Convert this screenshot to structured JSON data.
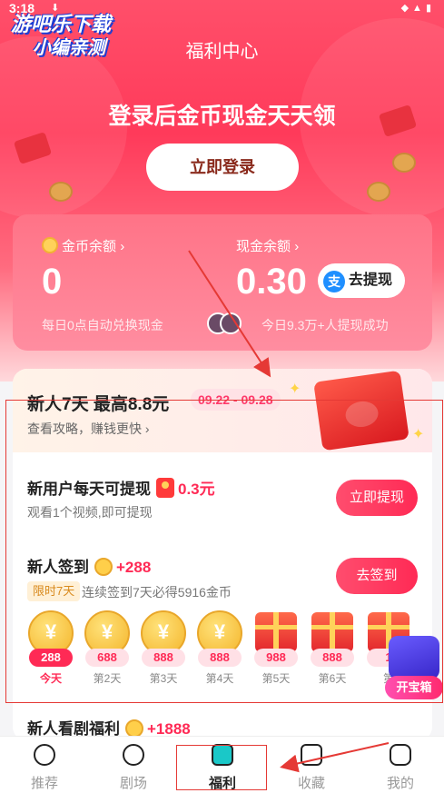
{
  "status_bar": {
    "time": "3:18"
  },
  "watermark": {
    "line1": "游吧乐下载",
    "line2": "小编亲测"
  },
  "header": {
    "title": "福利中心",
    "headline": "登录后金币现金天天领",
    "login_button": "立即登录"
  },
  "wallet": {
    "coin_label": "金币余额",
    "coin_value": "0",
    "coin_note": "每日0点自动兑换现金",
    "cash_label": "现金余额",
    "cash_value": "0.30",
    "withdraw_button": "去提现",
    "social_note": "今日9.3万+人提现成功"
  },
  "newbie": {
    "title": "新人7天 最高8.8元",
    "date_range": "09.22 - 09.28",
    "strategy_link": "查看攻略，赚钱更快"
  },
  "daily_withdraw": {
    "title": "新用户每天可提现",
    "amount": "0.3元",
    "desc": "观看1个视频,即可提现",
    "button": "立即提现"
  },
  "signin": {
    "title": "新人签到",
    "bonus": "+288",
    "limit_tag": "限时7天",
    "desc": "连续签到7天必得5916金币",
    "button": "去签到",
    "days": [
      {
        "amount": "288",
        "label": "今天",
        "type": "coin",
        "today": true
      },
      {
        "amount": "688",
        "label": "第2天",
        "type": "coin"
      },
      {
        "amount": "888",
        "label": "第3天",
        "type": "coin"
      },
      {
        "amount": "888",
        "label": "第4天",
        "type": "coin"
      },
      {
        "amount": "988",
        "label": "第5天",
        "type": "gift"
      },
      {
        "amount": "888",
        "label": "第6天",
        "type": "gift"
      },
      {
        "amount": "1",
        "label": "第",
        "type": "gift"
      }
    ]
  },
  "chest": {
    "label": "开宝箱"
  },
  "drama": {
    "title": "新人看剧福利",
    "bonus": "+1888"
  },
  "tabbar": {
    "tabs": [
      {
        "label": "推荐"
      },
      {
        "label": "剧场"
      },
      {
        "label": "福利",
        "active": true
      },
      {
        "label": "收藏"
      },
      {
        "label": "我的"
      }
    ]
  },
  "colors": {
    "accent": "#ff2a55",
    "hero_top": "#ff4f6a",
    "annotation": "#e53935"
  }
}
